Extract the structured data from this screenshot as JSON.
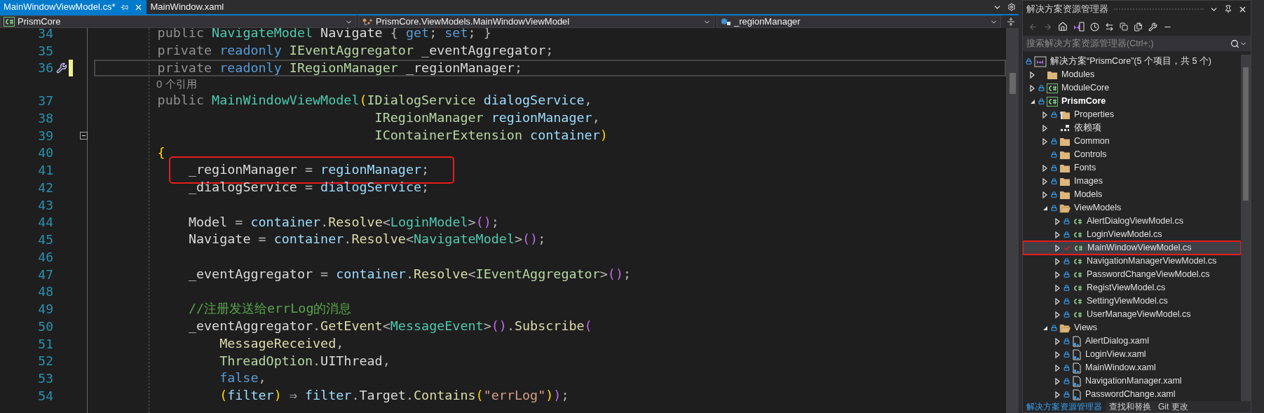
{
  "editor_tabs": [
    {
      "label": "MainWindowViewModel.cs*",
      "selected": true
    },
    {
      "label": "MainWindow.xaml",
      "selected": false
    }
  ],
  "nav_bar": {
    "project": "PrismCore",
    "type": "PrismCore.ViewModels.MainWindowViewModel",
    "member": "_regionManager"
  },
  "code_lines": [
    {
      "kind": "code",
      "number": "34",
      "current": false,
      "modified": false,
      "highlighted": false,
      "tokens": [
        {
          "kind": "mod",
          "text": "        public"
        },
        {
          "kind": "type",
          "text": " NavigateModel"
        },
        {
          "kind": "id",
          "text": " Navigate"
        },
        {
          "kind": "p",
          "text": " {"
        },
        {
          "kind": "kw",
          "text": " get"
        },
        {
          "kind": "p",
          "text": ";"
        },
        {
          "kind": "kw",
          "text": " set"
        },
        {
          "kind": "p",
          "text": ";"
        },
        {
          "kind": "p",
          "text": " }"
        }
      ]
    },
    {
      "kind": "code",
      "number": "35",
      "current": false,
      "modified": false,
      "highlighted": false,
      "tokens": [
        {
          "kind": "mod",
          "text": "        private"
        },
        {
          "kind": "kw",
          "text": " readonly"
        },
        {
          "kind": "iface",
          "text": " IEventAggregator"
        },
        {
          "kind": "id",
          "text": " _eventAggregator"
        },
        {
          "kind": "p",
          "text": ";"
        }
      ]
    },
    {
      "kind": "code",
      "number": "36",
      "current": true,
      "modified": true,
      "highlighted": false,
      "tokens": [
        {
          "kind": "mod",
          "text": "        private"
        },
        {
          "kind": "kw",
          "text": " readonly"
        },
        {
          "kind": "iface",
          "text": " IRegionManager"
        },
        {
          "kind": "id",
          "text": " _regionManager"
        },
        {
          "kind": "p",
          "text": ";"
        }
      ]
    },
    {
      "kind": "codelens",
      "text": "0 个引用"
    },
    {
      "kind": "code",
      "number": "37",
      "current": false,
      "modified": false,
      "highlighted": false,
      "tokens": [
        {
          "kind": "mod",
          "text": "        public"
        },
        {
          "kind": "type",
          "text": " MainWindowViewModel"
        },
        {
          "kind": "br1",
          "text": "("
        },
        {
          "kind": "iface",
          "text": "IDialogService"
        },
        {
          "kind": "param",
          "text": " dialogService"
        },
        {
          "kind": "p",
          "text": ","
        }
      ]
    },
    {
      "kind": "code",
      "number": "38",
      "current": false,
      "modified": false,
      "highlighted": false,
      "tokens": [
        {
          "kind": "iface",
          "text": "                                    IRegionManager"
        },
        {
          "kind": "param",
          "text": " regionManager"
        },
        {
          "kind": "p",
          "text": ","
        }
      ]
    },
    {
      "kind": "code",
      "number": "39",
      "current": false,
      "modified": false,
      "highlighted": false,
      "fold": {
        "expanded": true
      },
      "tokens": [
        {
          "kind": "iface",
          "text": "                                    IContainerExtension"
        },
        {
          "kind": "param",
          "text": " container"
        },
        {
          "kind": "br1",
          "text": ")"
        }
      ]
    },
    {
      "kind": "code",
      "number": "40",
      "current": false,
      "modified": false,
      "highlighted": false,
      "tokens": [
        {
          "kind": "br1",
          "text": "        {"
        }
      ]
    },
    {
      "kind": "code",
      "number": "41",
      "current": false,
      "modified": false,
      "highlighted": true,
      "tokens": [
        {
          "kind": "id",
          "text": "            _regionManager"
        },
        {
          "kind": "p",
          "text": " ="
        },
        {
          "kind": "param",
          "text": " regionManager"
        },
        {
          "kind": "p",
          "text": ";"
        }
      ]
    },
    {
      "kind": "code",
      "number": "42",
      "current": false,
      "modified": false,
      "highlighted": false,
      "tokens": [
        {
          "kind": "id",
          "text": "            _dialogService"
        },
        {
          "kind": "p",
          "text": " ="
        },
        {
          "kind": "param",
          "text": " dialogService"
        },
        {
          "kind": "p",
          "text": ";"
        }
      ]
    },
    {
      "kind": "code",
      "number": "43",
      "current": false,
      "modified": false
    },
    {
      "kind": "code",
      "number": "44",
      "current": false,
      "modified": false,
      "highlighted": false,
      "tokens": [
        {
          "kind": "id",
          "text": "            Model"
        },
        {
          "kind": "p",
          "text": " ="
        },
        {
          "kind": "param",
          "text": " container"
        },
        {
          "kind": "p",
          "text": "."
        },
        {
          "kind": "method",
          "text": "Resolve"
        },
        {
          "kind": "p",
          "text": "<"
        },
        {
          "kind": "type",
          "text": "LoginModel"
        },
        {
          "kind": "p",
          "text": ">"
        },
        {
          "kind": "br2",
          "text": "()"
        },
        {
          "kind": "p",
          "text": ";"
        }
      ]
    },
    {
      "kind": "code",
      "number": "45",
      "current": false,
      "modified": false,
      "highlighted": false,
      "tokens": [
        {
          "kind": "id",
          "text": "            Navigate"
        },
        {
          "kind": "p",
          "text": " ="
        },
        {
          "kind": "param",
          "text": " container"
        },
        {
          "kind": "p",
          "text": "."
        },
        {
          "kind": "method",
          "text": "Resolve"
        },
        {
          "kind": "p",
          "text": "<"
        },
        {
          "kind": "type",
          "text": "NavigateModel"
        },
        {
          "kind": "p",
          "text": ">"
        },
        {
          "kind": "br2",
          "text": "()"
        },
        {
          "kind": "p",
          "text": ";"
        }
      ]
    },
    {
      "kind": "code",
      "number": "46",
      "current": false,
      "modified": false
    },
    {
      "kind": "code",
      "number": "47",
      "current": false,
      "modified": false,
      "highlighted": false,
      "tokens": [
        {
          "kind": "id",
          "text": "            _eventAggregator"
        },
        {
          "kind": "p",
          "text": " ="
        },
        {
          "kind": "param",
          "text": " container"
        },
        {
          "kind": "p",
          "text": "."
        },
        {
          "kind": "method",
          "text": "Resolve"
        },
        {
          "kind": "p",
          "text": "<"
        },
        {
          "kind": "iface",
          "text": "IEventAggregator"
        },
        {
          "kind": "p",
          "text": ">"
        },
        {
          "kind": "br2",
          "text": "()"
        },
        {
          "kind": "p",
          "text": ";"
        }
      ]
    },
    {
      "kind": "code",
      "number": "48",
      "current": false,
      "modified": false
    },
    {
      "kind": "code",
      "number": "49",
      "current": false,
      "modified": false,
      "highlighted": false,
      "tokens": [
        {
          "kind": "comment",
          "text": "            //注册发送给errLog的消息"
        }
      ]
    },
    {
      "kind": "code",
      "number": "50",
      "current": false,
      "modified": false,
      "highlighted": false,
      "tokens": [
        {
          "kind": "id",
          "text": "            _eventAggregator"
        },
        {
          "kind": "p",
          "text": "."
        },
        {
          "kind": "method",
          "text": "GetEvent"
        },
        {
          "kind": "p",
          "text": "<"
        },
        {
          "kind": "type",
          "text": "MessageEvent"
        },
        {
          "kind": "p",
          "text": ">"
        },
        {
          "kind": "br2",
          "text": "()"
        },
        {
          "kind": "p",
          "text": "."
        },
        {
          "kind": "method",
          "text": "Subscribe"
        },
        {
          "kind": "br2",
          "text": "("
        }
      ]
    },
    {
      "kind": "code",
      "number": "51",
      "current": false,
      "modified": false,
      "highlighted": false,
      "tokens": [
        {
          "kind": "method",
          "text": "                MessageReceived"
        },
        {
          "kind": "p",
          "text": ","
        }
      ]
    },
    {
      "kind": "code",
      "number": "52",
      "current": false,
      "modified": false,
      "highlighted": false,
      "tokens": [
        {
          "kind": "iface",
          "text": "                ThreadOption"
        },
        {
          "kind": "p",
          "text": "."
        },
        {
          "kind": "id",
          "text": "UIThread"
        },
        {
          "kind": "p",
          "text": ","
        }
      ]
    },
    {
      "kind": "code",
      "number": "53",
      "current": false,
      "modified": false,
      "highlighted": false,
      "tokens": [
        {
          "kind": "kw",
          "text": "                false"
        },
        {
          "kind": "p",
          "text": ","
        }
      ]
    },
    {
      "kind": "code",
      "number": "54",
      "current": false,
      "modified": false,
      "highlighted": false,
      "tokens": [
        {
          "kind": "br1",
          "text": "                ("
        },
        {
          "kind": "param",
          "text": "filter"
        },
        {
          "kind": "br1",
          "text": ")"
        },
        {
          "kind": "p",
          "text": " ⇒"
        },
        {
          "kind": "param",
          "text": " filter"
        },
        {
          "kind": "p",
          "text": "."
        },
        {
          "kind": "id",
          "text": "Target"
        },
        {
          "kind": "p",
          "text": "."
        },
        {
          "kind": "method",
          "text": "Contains"
        },
        {
          "kind": "br1",
          "text": "("
        },
        {
          "kind": "string",
          "text": "\"errLog\""
        },
        {
          "kind": "br1",
          "text": ")"
        },
        {
          "kind": "br2",
          "text": ")"
        },
        {
          "kind": "p",
          "text": ";"
        }
      ]
    }
  ],
  "solution_explorer": {
    "title": "解决方案资源管理器",
    "search": {
      "placeholder": "搜索解决方案资源管理器(Ctrl+;)"
    },
    "tree": [
      {
        "label": "解决方案“PrismCore”(5 个项目，共 5 个)",
        "kind": "solution",
        "locked": true,
        "edited": false,
        "highlighted": false,
        "children": [
          {
            "label": "Modules",
            "kind": "folder",
            "locked": false,
            "edited": false,
            "expanded": false,
            "highlighted": false
          },
          {
            "label": "ModuleCore",
            "kind": "project",
            "locked": true,
            "edited": false,
            "expanded": false,
            "highlighted": false
          },
          {
            "label": "PrismCore",
            "kind": "project",
            "locked": true,
            "edited": false,
            "expanded": true,
            "highlighted": false,
            "children": [
              {
                "label": "Properties",
                "kind": "properties",
                "locked": true,
                "edited": false,
                "expanded": false,
                "highlighted": false
              },
              {
                "label": "依赖项",
                "kind": "dependencies",
                "locked": false,
                "edited": false,
                "expanded": false,
                "highlighted": false
              },
              {
                "label": "Common",
                "kind": "folder",
                "locked": true,
                "edited": false,
                "expanded": false,
                "highlighted": false
              },
              {
                "label": "Controls",
                "kind": "folder",
                "locked": true,
                "edited": false,
                "highlighted": false
              },
              {
                "label": "Fonts",
                "kind": "folder",
                "locked": true,
                "edited": false,
                "expanded": false,
                "highlighted": false
              },
              {
                "label": "Images",
                "kind": "folder",
                "locked": true,
                "edited": false,
                "expanded": false,
                "highlighted": false
              },
              {
                "label": "Models",
                "kind": "folder",
                "locked": true,
                "edited": false,
                "expanded": false,
                "highlighted": false
              },
              {
                "label": "ViewModels",
                "kind": "folder",
                "locked": true,
                "edited": false,
                "expanded": true,
                "highlighted": false,
                "children": [
                  {
                    "label": "AlertDialogViewModel.cs",
                    "kind": "csharp",
                    "locked": true,
                    "edited": false,
                    "expanded": false,
                    "highlighted": false
                  },
                  {
                    "label": "LoginViewModel.cs",
                    "kind": "csharp",
                    "locked": true,
                    "edited": false,
                    "expanded": false,
                    "highlighted": false
                  },
                  {
                    "label": "MainWindowViewModel.cs",
                    "kind": "csharp",
                    "edited": true,
                    "expanded": false,
                    "highlighted": true
                  },
                  {
                    "label": "NavigationManagerViewModel.cs",
                    "kind": "csharp",
                    "locked": true,
                    "edited": false,
                    "expanded": false,
                    "highlighted": false
                  },
                  {
                    "label": "PasswordChangeViewModel.cs",
                    "kind": "csharp",
                    "locked": true,
                    "edited": false,
                    "expanded": false,
                    "highlighted": false
                  },
                  {
                    "label": "RegistViewModel.cs",
                    "kind": "csharp",
                    "locked": true,
                    "edited": false,
                    "expanded": false,
                    "highlighted": false
                  },
                  {
                    "label": "SettingViewModel.cs",
                    "kind": "csharp",
                    "locked": true,
                    "edited": false,
                    "expanded": false,
                    "highlighted": false
                  },
                  {
                    "label": "UserManageViewModel.cs",
                    "kind": "csharp",
                    "locked": true,
                    "edited": false,
                    "expanded": false,
                    "highlighted": false
                  }
                ]
              },
              {
                "label": "Views",
                "kind": "folder",
                "locked": true,
                "edited": false,
                "expanded": true,
                "highlighted": false,
                "children": [
                  {
                    "label": "AlertDialog.xaml",
                    "kind": "xaml",
                    "locked": true,
                    "edited": false,
                    "expanded": false,
                    "highlighted": false
                  },
                  {
                    "label": "LoginView.xaml",
                    "kind": "xaml",
                    "locked": true,
                    "edited": false,
                    "expanded": false,
                    "highlighted": false
                  },
                  {
                    "label": "MainWindow.xaml",
                    "kind": "xaml",
                    "locked": true,
                    "edited": false,
                    "expanded": false,
                    "highlighted": false
                  },
                  {
                    "label": "NavigationManager.xaml",
                    "kind": "xaml",
                    "locked": true,
                    "edited": false,
                    "expanded": false,
                    "highlighted": false
                  },
                  {
                    "label": "PasswordChange.xaml",
                    "kind": "xaml",
                    "locked": true,
                    "edited": false,
                    "expanded": false,
                    "highlighted": false
                  }
                ]
              }
            ]
          }
        ]
      }
    ],
    "bottom_tabs": [
      {
        "label": "解决方案资源管理器",
        "selected": true
      },
      {
        "label": "查找和替换",
        "selected": false
      },
      {
        "label": "Git 更改",
        "selected": false
      }
    ]
  }
}
